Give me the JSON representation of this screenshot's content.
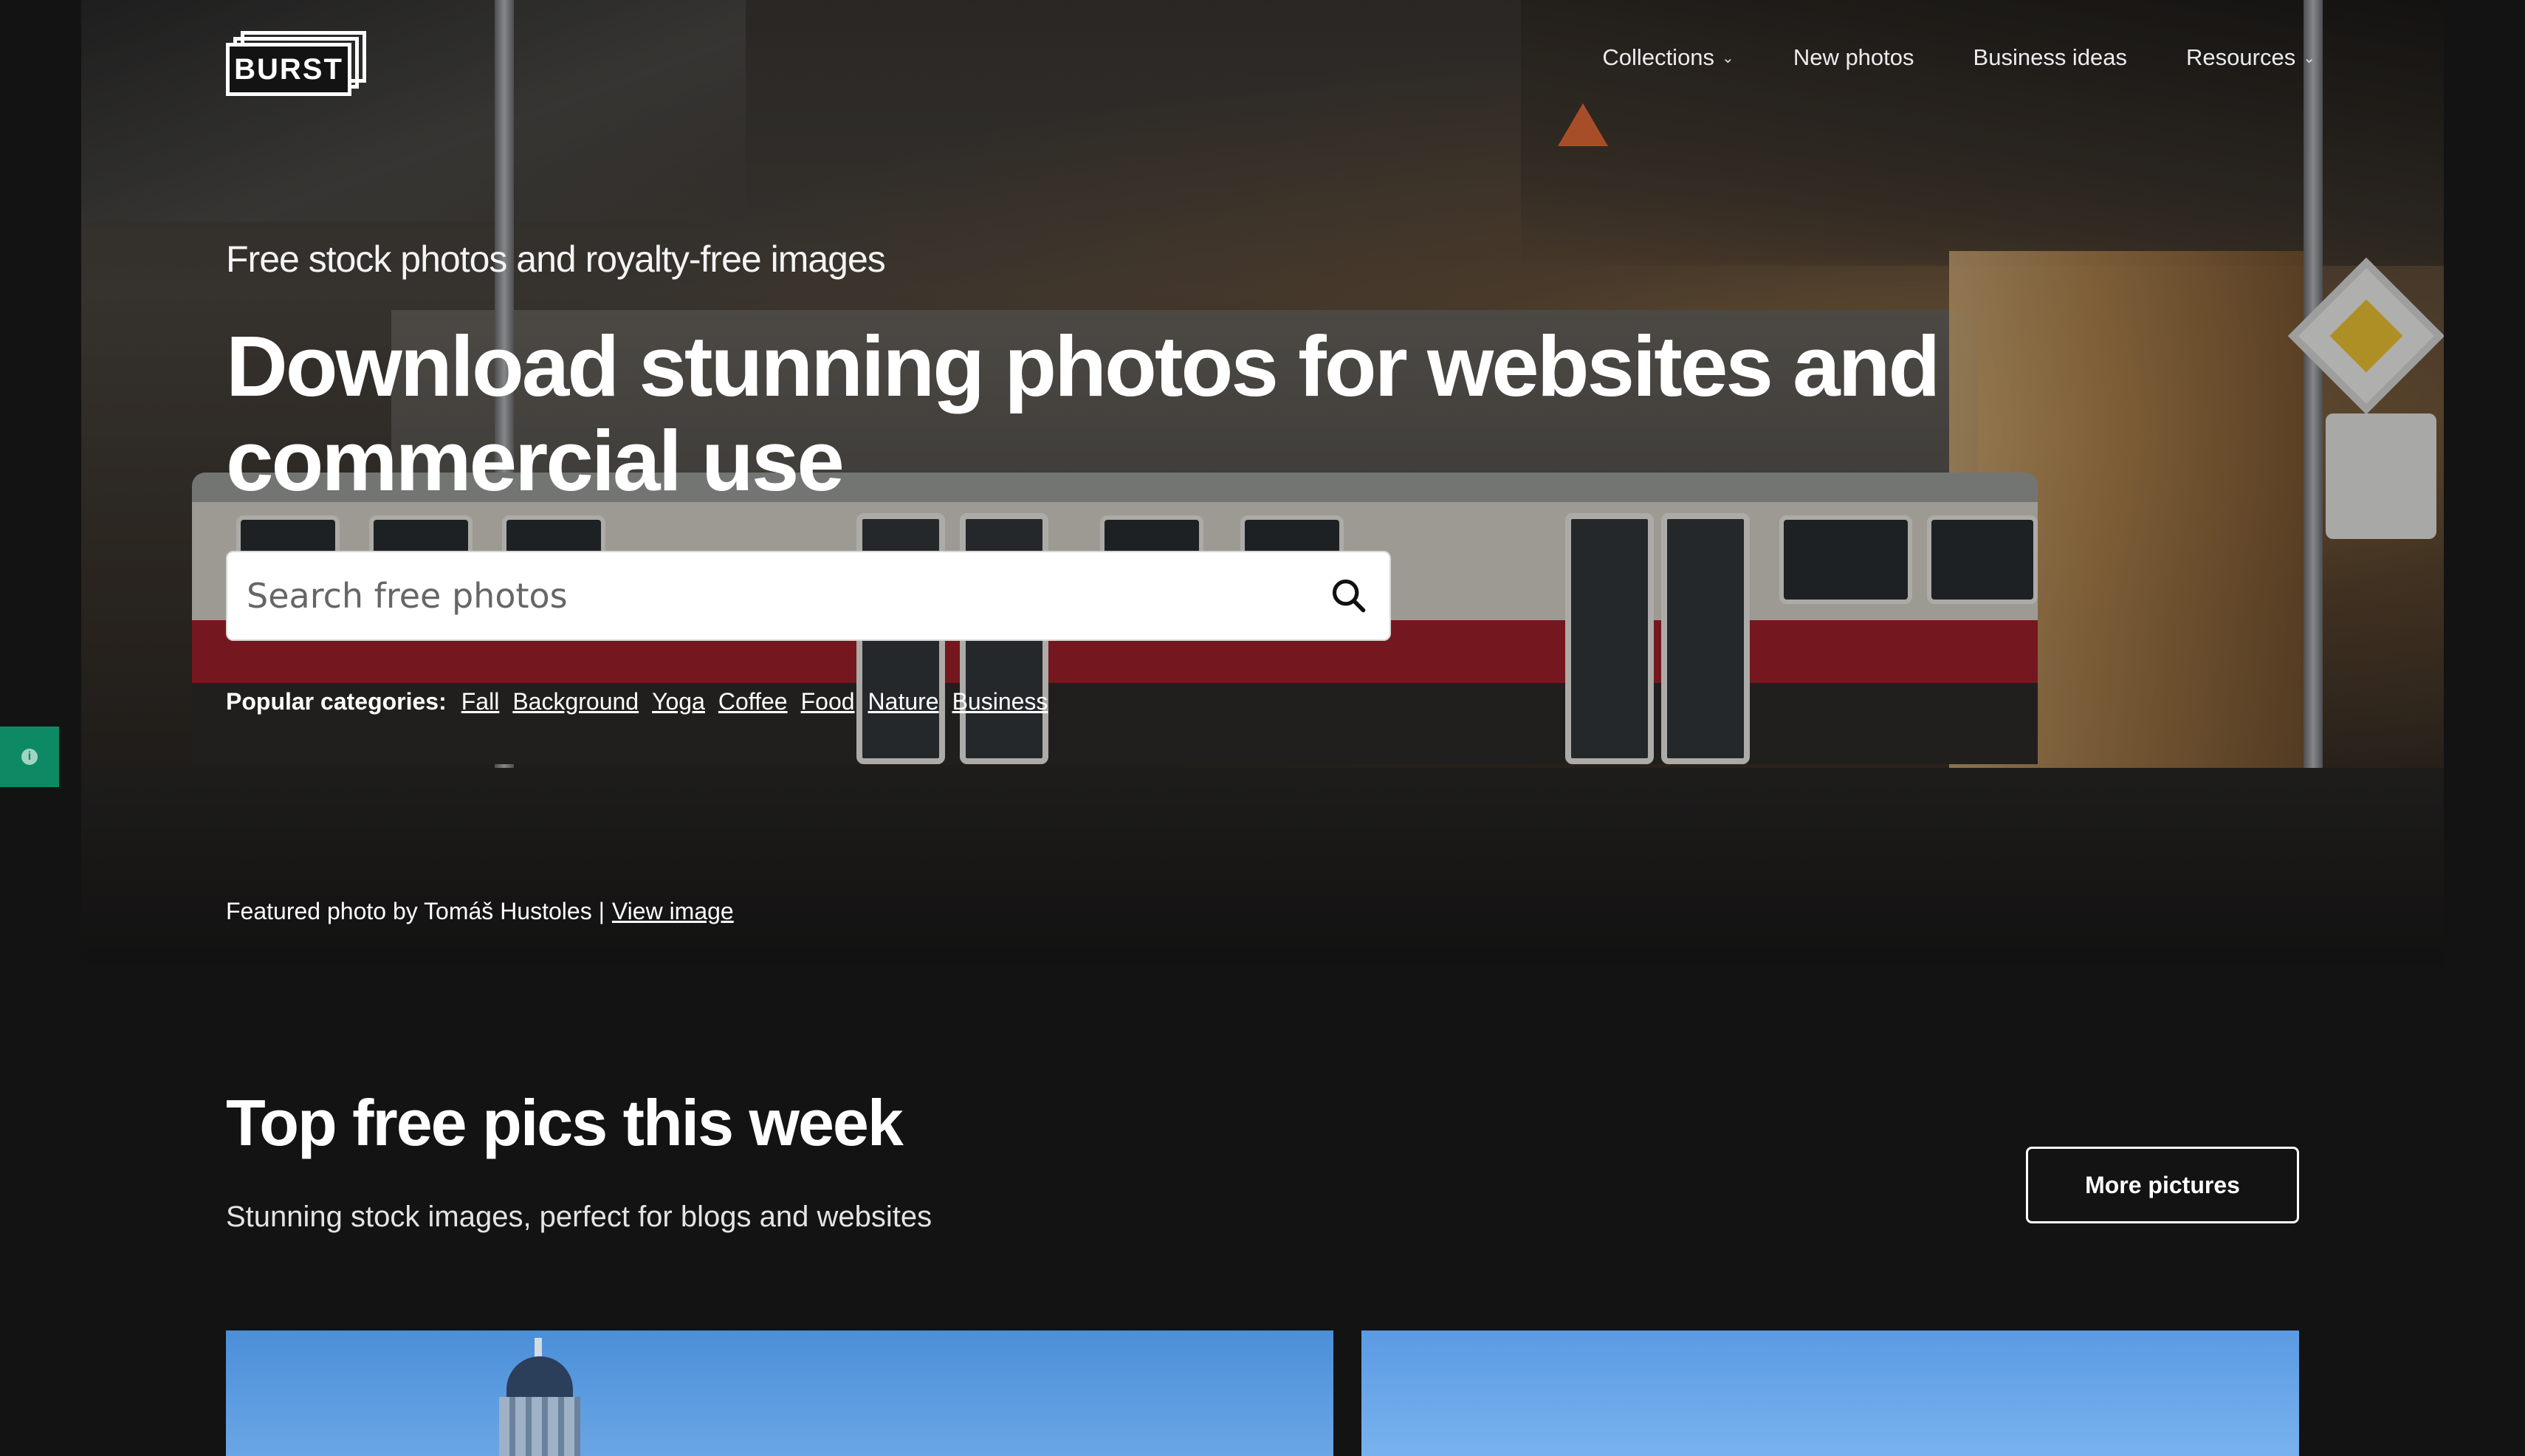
{
  "brand": {
    "logo_text": "BURST"
  },
  "nav": {
    "items": [
      {
        "label": "Collections",
        "has_dropdown": true
      },
      {
        "label": "New photos",
        "has_dropdown": false
      },
      {
        "label": "Business ideas",
        "has_dropdown": false
      },
      {
        "label": "Resources",
        "has_dropdown": true
      }
    ]
  },
  "hero": {
    "eyebrow": "Free stock photos and royalty-free images",
    "title": "Download stunning photos for websites and commercial use",
    "search": {
      "placeholder": "Search free photos",
      "value": ""
    },
    "categories": {
      "label": "Popular categories:",
      "items": [
        "Fall",
        "Background",
        "Yoga",
        "Coffee",
        "Food",
        "Nature",
        "Business"
      ]
    },
    "credit": {
      "text": "Featured photo by Tomáš Hustoles |",
      "link": "View image"
    }
  },
  "section": {
    "title": "Top free pics this week",
    "subtitle": "Stunning stock images, perfect for blogs and websites",
    "more_button": "More pictures"
  },
  "colors": {
    "page_bg": "#131313",
    "info_tab": "#0d8a63",
    "tram_red": "#a3212a"
  }
}
